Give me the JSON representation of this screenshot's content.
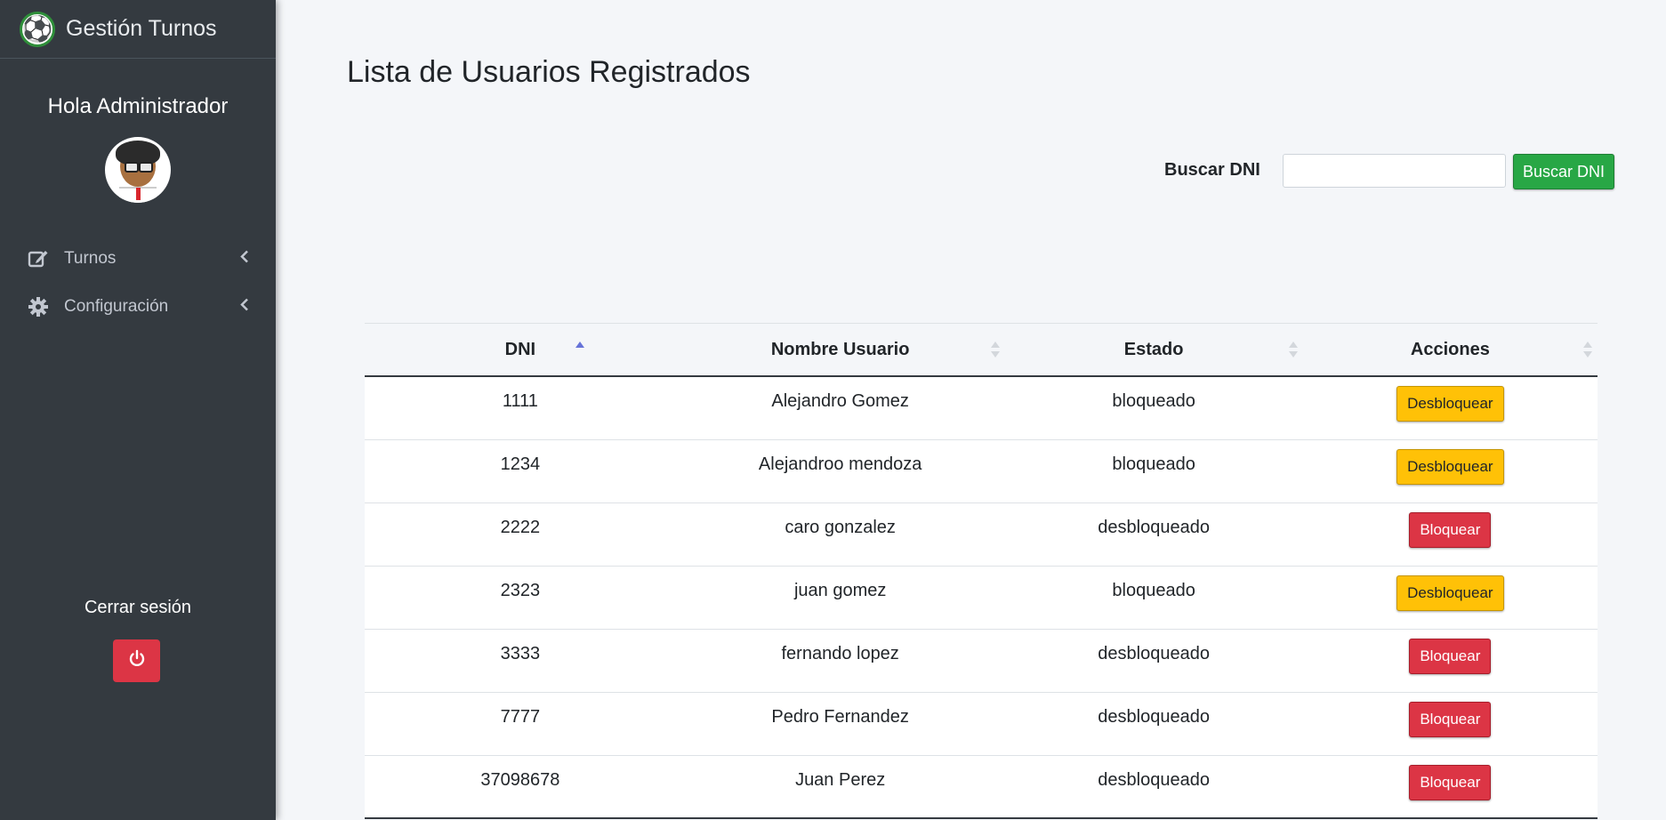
{
  "brand": {
    "title": "Gestión Turnos",
    "logo_icon": "soccer-ball-icon"
  },
  "sidebar": {
    "greeting": "Hola Administrador",
    "items": [
      {
        "label": "Turnos",
        "icon": "edit-icon"
      },
      {
        "label": "Configuración",
        "icon": "gear-icon"
      }
    ],
    "logout_label": "Cerrar sesión",
    "logout_icon": "power-icon"
  },
  "main": {
    "title": "Lista de Usuarios Registrados",
    "search": {
      "label": "Buscar DNI",
      "value": "",
      "placeholder": "",
      "button_label": "Buscar DNI"
    }
  },
  "table": {
    "columns": [
      "DNI",
      "Nombre Usuario",
      "Estado",
      "Acciones"
    ],
    "sorted_column": "DNI",
    "sort_direction": "asc",
    "rows": [
      {
        "dni": "1111",
        "nombre": "Alejandro Gomez",
        "estado": "bloqueado",
        "accion": "Desbloquear"
      },
      {
        "dni": "1234",
        "nombre": "Alejandroo mendoza",
        "estado": "bloqueado",
        "accion": "Desbloquear"
      },
      {
        "dni": "2222",
        "nombre": "caro gonzalez",
        "estado": "desbloqueado",
        "accion": "Bloquear"
      },
      {
        "dni": "2323",
        "nombre": "juan gomez",
        "estado": "bloqueado",
        "accion": "Desbloquear"
      },
      {
        "dni": "3333",
        "nombre": "fernando lopez",
        "estado": "desbloqueado",
        "accion": "Bloquear"
      },
      {
        "dni": "7777",
        "nombre": "Pedro Fernandez",
        "estado": "desbloqueado",
        "accion": "Bloquear"
      },
      {
        "dni": "37098678",
        "nombre": "Juan Perez",
        "estado": "desbloqueado",
        "accion": "Bloquear"
      }
    ]
  },
  "colors": {
    "sidebar_bg": "#343a40",
    "primary_success": "#28a745",
    "warning": "#ffc107",
    "danger": "#dc3545"
  }
}
